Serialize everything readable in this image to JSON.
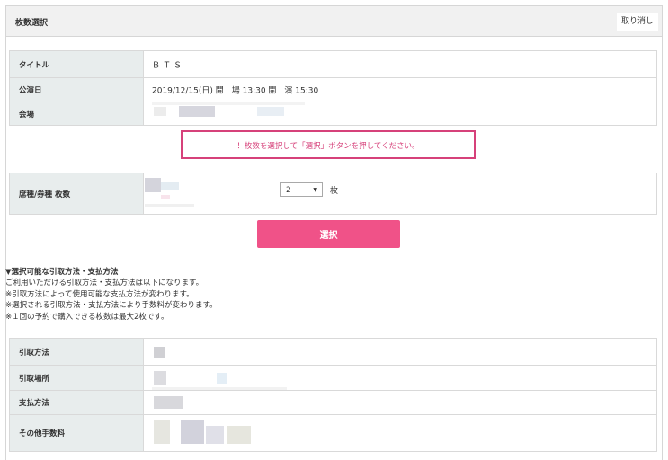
{
  "header": {
    "title": "枚数選択",
    "cancel_label": "取り消し"
  },
  "event_table": {
    "rows": [
      {
        "label": "タイトル",
        "value": "ＢＴＳ"
      },
      {
        "label": "公演日",
        "value": "2019/12/15(日) 開　場 13:30 開　演 15:30"
      },
      {
        "label": "会場",
        "value": ""
      }
    ]
  },
  "notice": {
    "text": "！枚数を選択して「選択」ボタンを押してください。"
  },
  "seat_table": {
    "label": "席種/券種 枚数",
    "quantity": {
      "selected": "2",
      "unit": "枚"
    }
  },
  "select_button": {
    "label": "選択"
  },
  "info": {
    "title": "▼選択可能な引取方法・支払方法",
    "lines": [
      "ご利用いただける引取方法・支払方法は以下になります。",
      "※引取方法によって使用可能な支払方法が変わります。",
      "※選択される引取方法・支払方法により手数料が変わります。",
      "※１回の予約で購入できる枚数は最大2枚です。"
    ]
  },
  "method_table": {
    "rows": [
      {
        "label": "引取方法"
      },
      {
        "label": "引取場所"
      },
      {
        "label": "支払方法"
      },
      {
        "label": "その他手数料"
      }
    ]
  },
  "colors": {
    "accent": "#f05288",
    "notice_border": "#d6417a",
    "header_bg": "#f1f1f1",
    "label_bg": "#e8eded"
  }
}
